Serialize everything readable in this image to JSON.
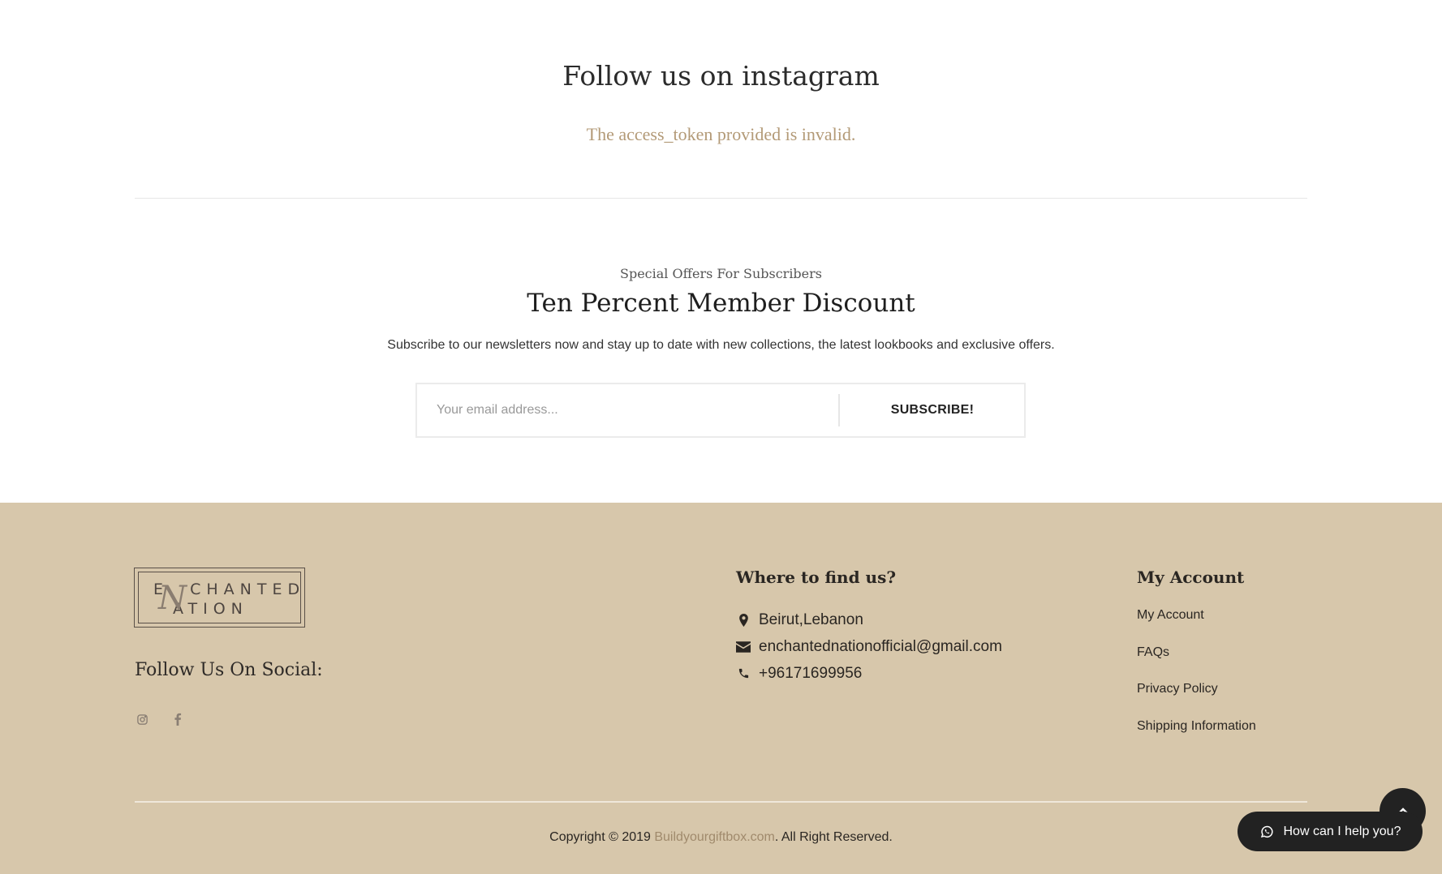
{
  "instagram": {
    "title": "Follow us on instagram",
    "error": "The access_token provided is invalid."
  },
  "newsletter": {
    "subtitle": "Special Offers For Subscribers",
    "title": "Ten Percent Member Discount",
    "description": "Subscribe to our newsletters now and stay up to date with new collections, the latest lookbooks and exclusive offers.",
    "email_placeholder": "Your email address...",
    "email_value": "",
    "button_label": "SUBSCRIBE!"
  },
  "footer": {
    "logo": {
      "text": "ENCHANTED NATION"
    },
    "social": {
      "heading": "Follow Us On Social:",
      "icons": [
        "instagram-icon",
        "facebook-icon"
      ]
    },
    "find_us": {
      "title": "Where to find us?",
      "location": "Beirut,Lebanon",
      "email": "enchantednationofficial@gmail.com",
      "phone": "+96171699956"
    },
    "account": {
      "title": "My Account",
      "links": [
        "My Account",
        "FAQs",
        "Privacy Policy",
        "Shipping Information"
      ]
    },
    "copyright": {
      "prefix": "Copyright © 2019 ",
      "brand": "Buildyourgiftbox.com",
      "suffix": ". All Right Reserved."
    }
  },
  "widgets": {
    "help_label": "How can I help you?",
    "help_icon": "whatsapp-icon",
    "scroll_top_icon": "chevron-up-icon"
  },
  "colors": {
    "footer_bg": "#d7c7ab",
    "accent": "#b39a77",
    "dark_button": "#222222"
  }
}
